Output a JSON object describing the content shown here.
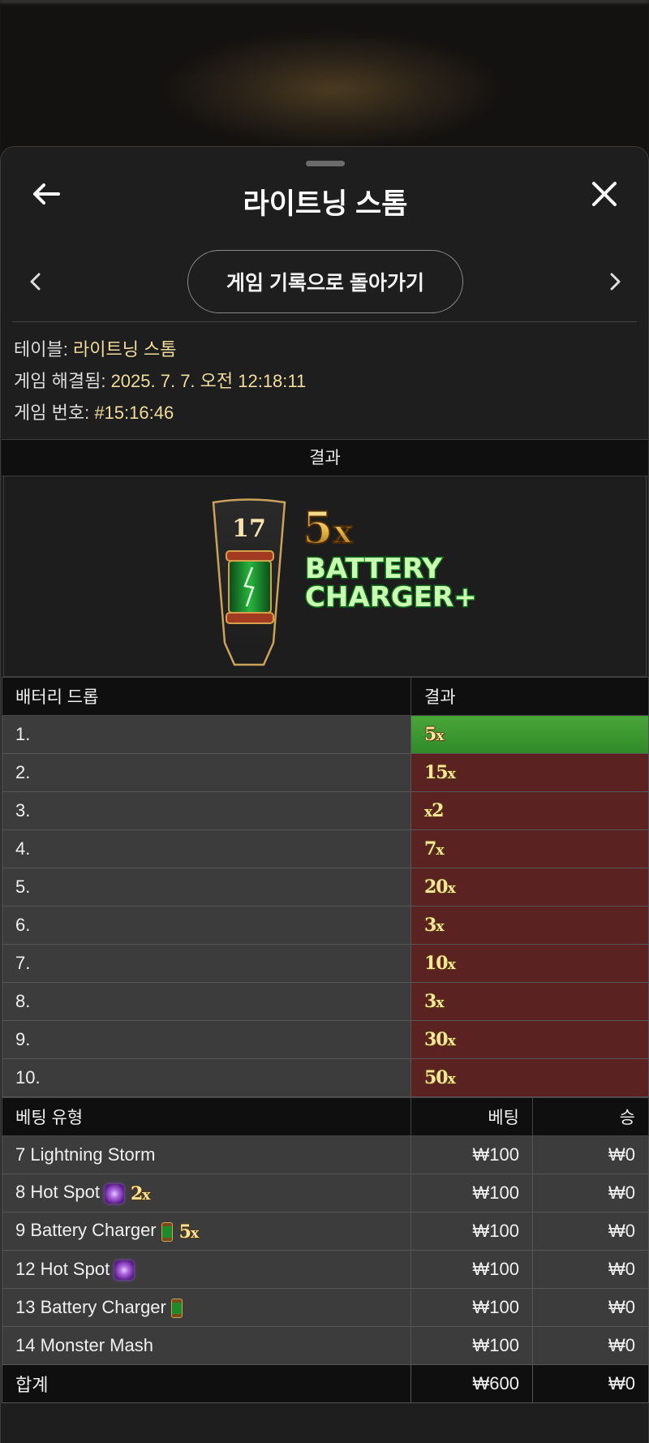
{
  "header": {
    "title": "라이트닝 스톰"
  },
  "nav": {
    "back_history_label": "게임 기록으로 돌아가기"
  },
  "info": {
    "table_label": "테이블:",
    "table_value": "라이트닝 스톰",
    "resolved_label": "게임 해결됨:",
    "resolved_value": "2025. 7. 7. 오전 12:18:11",
    "game_no_label": "게임 번호:",
    "game_no_value": "#15:16:46"
  },
  "result": {
    "heading": "결과",
    "number": "17",
    "multiplier_num": "5",
    "multiplier_x": "x",
    "name_line1": "BATTERY",
    "name_line2": "CHARGER+"
  },
  "battery_drop": {
    "col_label": "배터리 드롭",
    "col_result": "결과",
    "rows": [
      {
        "idx": "1.",
        "num": "5",
        "suffix": "x",
        "prefix": "",
        "win": true
      },
      {
        "idx": "2.",
        "num": "15",
        "suffix": "x",
        "prefix": ""
      },
      {
        "idx": "3.",
        "num": "2",
        "suffix": "",
        "prefix": "x"
      },
      {
        "idx": "4.",
        "num": "7",
        "suffix": "x",
        "prefix": ""
      },
      {
        "idx": "5.",
        "num": "20",
        "suffix": "x",
        "prefix": ""
      },
      {
        "idx": "6.",
        "num": "3",
        "suffix": "x",
        "prefix": ""
      },
      {
        "idx": "7.",
        "num": "10",
        "suffix": "x",
        "prefix": ""
      },
      {
        "idx": "8.",
        "num": "3",
        "suffix": "x",
        "prefix": ""
      },
      {
        "idx": "9.",
        "num": "30",
        "suffix": "x",
        "prefix": ""
      },
      {
        "idx": "10.",
        "num": "50",
        "suffix": "x",
        "prefix": ""
      }
    ]
  },
  "bets": {
    "col_type": "베팅 유형",
    "col_bet": "베팅",
    "col_win": "승",
    "rows": [
      {
        "type": "7 Lightning Storm",
        "bet": "₩100",
        "win": "₩0"
      },
      {
        "type": "8 Hot Spot",
        "icon": "hot-spot-orb-icon",
        "mult": "2",
        "bet": "₩100",
        "win": "₩0"
      },
      {
        "type": "9 Battery Charger",
        "icon": "battery-icon",
        "mult": "5",
        "bet": "₩100",
        "win": "₩0"
      },
      {
        "type": "12 Hot Spot",
        "icon": "hot-spot-orb-icon",
        "bet": "₩100",
        "win": "₩0"
      },
      {
        "type": "13 Battery Charger",
        "icon": "battery-icon",
        "bet": "₩100",
        "win": "₩0"
      },
      {
        "type": "14 Monster Mash",
        "bet": "₩100",
        "win": "₩0"
      }
    ],
    "mult_x": "x",
    "total_label": "합계",
    "total_bet": "₩600",
    "total_win": "₩0"
  },
  "colors": {
    "win_green": "#3e9a32",
    "loss_red": "#5b2222",
    "gold": "#fbe5a0"
  }
}
